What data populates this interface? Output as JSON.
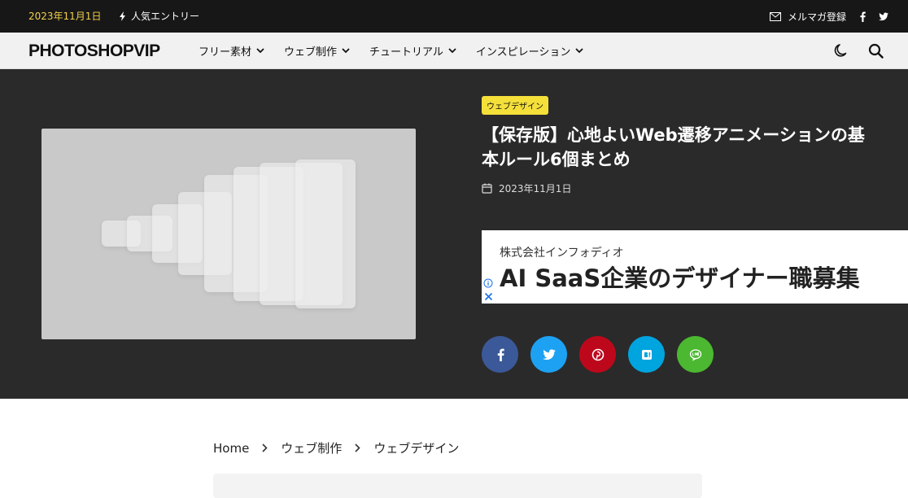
{
  "topbar": {
    "date": "2023年11月1日",
    "trending_label": "人気エントリー",
    "newsletter_label": "メルマガ登録"
  },
  "nav": {
    "logo": "PHOTOSHOPVIP",
    "menu": [
      {
        "label": "フリー素材"
      },
      {
        "label": "ウェブ制作"
      },
      {
        "label": "チュートリアル"
      },
      {
        "label": "インスピレーション"
      }
    ]
  },
  "article": {
    "category": "ウェブデザイン",
    "title": "【保存版】心地よいWeb遷移アニメーションの基本ルール6個まとめ",
    "date": "2023年11月1日"
  },
  "ad": {
    "company": "株式会社インフォディオ",
    "headline": "AI SaaS企業のデザイナー職募集"
  },
  "share_colors": {
    "facebook": "#3b5998",
    "twitter": "#1da1f2",
    "pinterest": "#bd081c",
    "hatena": "#00a4de",
    "line": "#4cb831"
  },
  "breadcrumb": {
    "items": [
      "Home",
      "ウェブ制作",
      "ウェブデザイン"
    ]
  },
  "colors": {
    "accent_yellow": "#f5e03a",
    "topbar_bg": "#171717",
    "hero_bg": "#2a2a2a"
  }
}
